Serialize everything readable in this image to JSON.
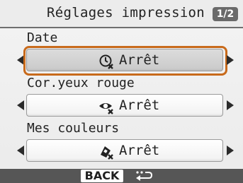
{
  "header": {
    "title": "Réglages impression",
    "page_indicator": "1/2"
  },
  "settings": [
    {
      "label": "Date",
      "value": "Arrêt",
      "icon": "date-off-icon",
      "selected": true
    },
    {
      "label": "Cor.yeux rouge",
      "value": "Arrêt",
      "icon": "red-eye-off-icon",
      "selected": false
    },
    {
      "label": "Mes couleurs",
      "value": "Arrêt",
      "icon": "my-colors-off-icon",
      "selected": false
    }
  ],
  "footer": {
    "back_label": "BACK",
    "back_icon": "return-arrow-icon"
  },
  "colors": {
    "selection_ring": "#c86a1b",
    "footer_bar": "#565656",
    "badge": "#6a6a6a"
  }
}
